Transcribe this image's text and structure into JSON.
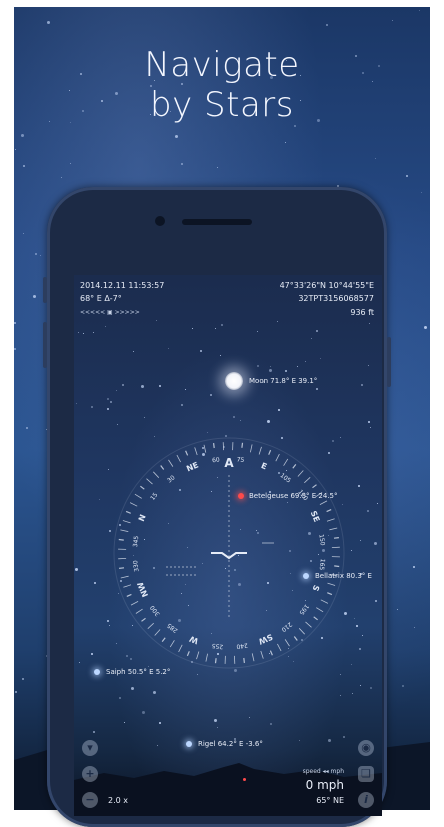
{
  "headline": {
    "line1": "Navigate",
    "line2": "by Stars"
  },
  "hud": {
    "datetime": "2014.12.11 11:53:57",
    "heading": "68° E Δ-7°",
    "coordinates": "47°33'26\"N 10°44'55\"E",
    "grid": "32TPT3156068577",
    "altitude": "936 ft",
    "time_slider": "<<<<< ▣ >>>>>"
  },
  "sky": {
    "moon": "Moon 71.8° E 39.1°",
    "betelgeuse": "Betelgeuse 69.5° E 24.5°",
    "bellatrix": "Bellatrix 80.3° E",
    "saiph": "Saiph 50.5° E 5.2°",
    "rigel": "Rigel 64.2° E -3.6°"
  },
  "compass": {
    "cardinals": [
      "N",
      "NE",
      "E",
      "SE",
      "S",
      "SW",
      "W",
      "NW"
    ],
    "degrees": [
      "15",
      "30",
      "60",
      "75",
      "105",
      "120",
      "150",
      "165",
      "195",
      "210",
      "240",
      "255",
      "285",
      "300",
      "330",
      "345"
    ],
    "top_marker": "A"
  },
  "bottom": {
    "zoom": "2.0 x",
    "speed_label": "speed ◂◂ mph",
    "speed_value": "0 mph",
    "heading": "65° NE"
  },
  "colors": {
    "sky_top": "#1b3766",
    "screen_bg": "#1f3660",
    "star_red": "#ff4a4a",
    "star_blue": "#bcd7ff"
  },
  "icons": [
    "chevron-down-icon",
    "plus-icon",
    "minus-icon",
    "camera-icon",
    "layers-icon",
    "info-icon"
  ]
}
